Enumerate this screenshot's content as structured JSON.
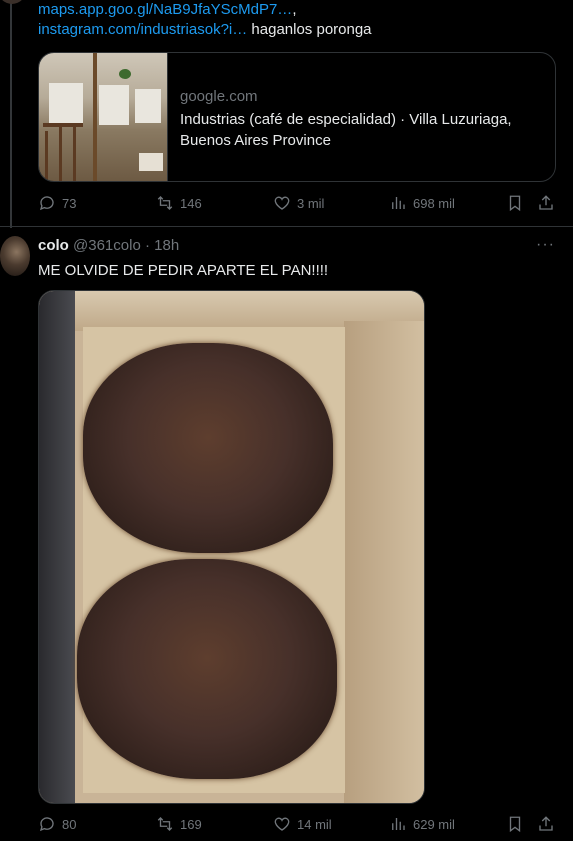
{
  "tweet1": {
    "links": {
      "maps_url": "maps.app.goo.gl/NaB9JfaYScMdP7…",
      "maps_suffix": ",",
      "instagram_url": "instagram.com/industriasok?i…",
      "instagram_suffix": " haganlos poronga"
    },
    "card": {
      "domain": "google.com",
      "title": "Industrias (café de especialidad) · Villa Luzuriaga, Buenos Aires Province"
    },
    "actions": {
      "replies": "73",
      "retweets": "146",
      "likes": "3 mil",
      "views": "698 mil"
    }
  },
  "tweet2": {
    "author": {
      "name": "colo",
      "handle": "@361colo",
      "separator": "·",
      "time": "18h"
    },
    "text": "ME OLVIDE DE PEDIR APARTE EL PAN!!!!",
    "actions": {
      "replies": "80",
      "retweets": "169",
      "likes": "14 mil",
      "views": "629 mil"
    }
  },
  "icons": {
    "reply": "comment-icon",
    "retweet": "retweet-icon",
    "like": "heart-icon",
    "views": "views-chart-icon",
    "bookmark": "bookmark-icon",
    "share": "share-icon",
    "more": "more-dots-icon"
  },
  "colors": {
    "background": "#000000",
    "link": "#1d9bf0",
    "text": "#e7e9ea",
    "muted": "#71767b",
    "border": "#2f3336"
  }
}
